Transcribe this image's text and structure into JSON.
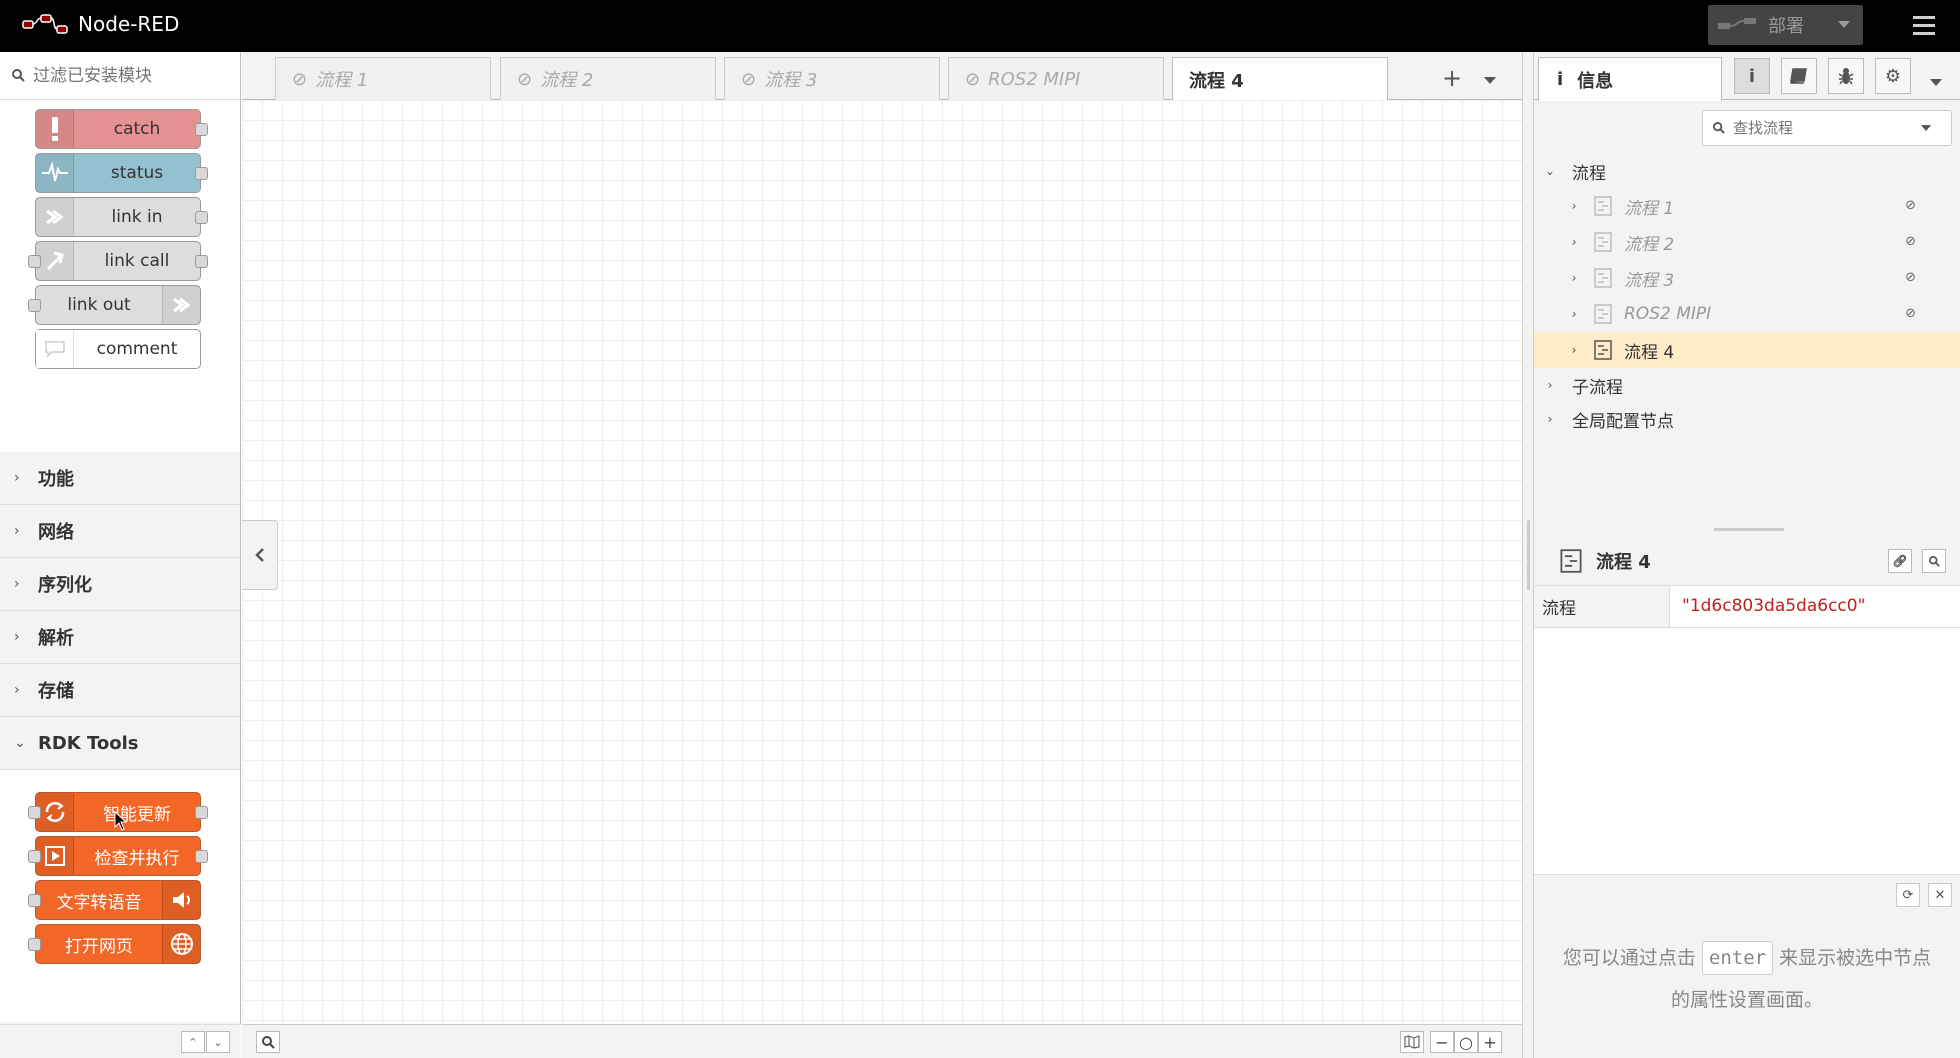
{
  "app": {
    "title": "Node-RED"
  },
  "header": {
    "deploy_label": "部署"
  },
  "palette": {
    "search_placeholder": "过滤已安装模块",
    "common_nodes": [
      {
        "label": "catch",
        "color": "#e49191",
        "icon": "alert-icon"
      },
      {
        "label": "status",
        "color": "#94c1d0",
        "icon": "pulse-icon"
      },
      {
        "label": "link in",
        "color": "#dddddd",
        "icon": "link-in-icon"
      },
      {
        "label": "link call",
        "color": "#dddddd",
        "icon": "link-call-icon"
      },
      {
        "label": "link out",
        "color": "#dddddd",
        "icon": "link-out-icon"
      },
      {
        "label": "comment",
        "color": "#ffffff",
        "icon": "comment-icon"
      }
    ],
    "categories": [
      {
        "label": "功能",
        "expanded": false
      },
      {
        "label": "网络",
        "expanded": false
      },
      {
        "label": "序列化",
        "expanded": false
      },
      {
        "label": "解析",
        "expanded": false
      },
      {
        "label": "存储",
        "expanded": false
      },
      {
        "label": "RDK Tools",
        "expanded": true
      }
    ],
    "rdk_nodes": [
      {
        "label": "智能更新",
        "icon": "refresh-icon"
      },
      {
        "label": "检查并执行",
        "icon": "play-icon"
      },
      {
        "label": "文字转语音",
        "icon": "speaker-icon"
      },
      {
        "label": "打开网页",
        "icon": "globe-icon"
      }
    ],
    "rdk_color": "#f26727"
  },
  "workspace": {
    "tabs": [
      {
        "label": "流程 1",
        "disabled": true
      },
      {
        "label": "流程 2",
        "disabled": true
      },
      {
        "label": "流程 3",
        "disabled": true
      },
      {
        "label": "ROS2 MIPI",
        "disabled": true
      },
      {
        "label": "流程 4",
        "disabled": false,
        "active": true
      }
    ]
  },
  "sidebar": {
    "active_tab": "信息",
    "search_placeholder": "查找流程",
    "tree": {
      "root_label": "流程",
      "flows": [
        {
          "label": "流程 1",
          "disabled": true
        },
        {
          "label": "流程 2",
          "disabled": true
        },
        {
          "label": "流程 3",
          "disabled": true
        },
        {
          "label": "ROS2 MIPI",
          "disabled": true
        },
        {
          "label": "流程 4",
          "disabled": false,
          "selected": true
        }
      ],
      "subflows_label": "子流程",
      "config_label": "全局配置节点"
    },
    "info": {
      "title": "流程 4",
      "prop_key": "流程",
      "prop_value": "\"1d6c803da5da6cc0\""
    },
    "help": {
      "before": "您可以通过点击",
      "key": "enter",
      "after": "来显示被选中节点的属性设置画面。"
    }
  }
}
